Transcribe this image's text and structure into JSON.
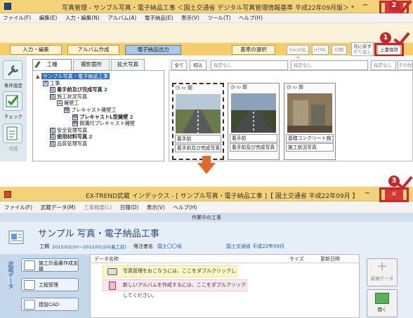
{
  "top": {
    "window_title": "写真管理 - サンプル写真・電子納品工事 ＜国土交通省 デジタル写真管理情報基準 平成22年09月版＞ *",
    "close_glyph": "×",
    "menu": [
      "ファイル(F)",
      "編集(E)",
      "入力・編集(N)",
      "アルバム(A)",
      "電子納品(E)",
      "表示(V)",
      "ツール(T)",
      "ヘルプ(H)"
    ],
    "tabs": [
      "入力・編集",
      "アルバム作成",
      "電子納品出力"
    ],
    "basis_button": "基準の選択",
    "tool_buttons": [
      "Excel出力",
      "HTML",
      "印刷"
    ],
    "undo_button": [
      "元に戻す",
      "やり直し"
    ],
    "save_button": "上書保存",
    "side_tools": [
      "条件設定",
      "チェック",
      "作成"
    ],
    "panel_tabs": [
      "工種",
      "撮影箇所",
      "拡大写真"
    ],
    "filter": {
      "all": "全て",
      "narrow": "絞込",
      "select1": "指定なし",
      "select2": "指定なし",
      "select3": "指定なし",
      "more": "その他条件"
    },
    "tree": [
      {
        "label": "サンプル写真・電子納品工事",
        "level": 0,
        "count": ""
      },
      {
        "label": "工事",
        "level": 1,
        "count": "",
        "tag": "大"
      },
      {
        "label": "着手前及び完成写真",
        "level": 2,
        "count": "2",
        "tag": "区"
      },
      {
        "label": "施工状況写真",
        "level": 2,
        "count": "",
        "tag": "区"
      },
      {
        "label": "擁壁工",
        "level": 3,
        "count": "",
        "tag": "工"
      },
      {
        "label": "プレキャスト擁壁工",
        "level": 4,
        "count": "",
        "tag": "種"
      },
      {
        "label": "プレキャストL型擁壁",
        "level": 5,
        "count": "2",
        "tag": "細"
      },
      {
        "label": "側溝付プレキャスト擁壁",
        "level": 5,
        "count": "",
        "tag": "細"
      },
      {
        "label": "安全管理写真",
        "level": 2,
        "count": "",
        "tag": "区"
      },
      {
        "label": "使用材料写真",
        "level": 2,
        "count": "2",
        "tag": "区"
      },
      {
        "label": "品質管理写真",
        "level": 2,
        "count": "",
        "tag": "区"
      }
    ],
    "photos": [
      {
        "icons": "◷ ▭ 前",
        "caption1": "着手前",
        "caption2": "着手前及び完成写真"
      },
      {
        "icons": "◷ ▭ 前",
        "caption1": "着手前",
        "caption2": "着手前及び完成写真"
      },
      {
        "icons": "◷ ▭ 前",
        "caption1": "基礎コンクリート施工...",
        "caption2": "施工状況写真"
      }
    ],
    "markers": [
      "2",
      "1"
    ]
  },
  "bottom": {
    "window_title": "EX-TREND武蔵 インデックス - [ サンプル写真・電子納品工事 ]【 国土交通省 平成22年09月 】",
    "close_glyph": "×",
    "menu": [
      "ファイル(F)",
      "武蔵データ(M)",
      "工事概要(L)",
      "日報(D)",
      "表示(V)",
      "ヘルプ(H)"
    ],
    "section_title": "作業中の工事",
    "project_name": "サンプル 写真・電子納品工事",
    "period_label": "工期",
    "period_value": "2015/03/20～2015/05/20(着工前)",
    "orderer_label": "発注者名",
    "orderer_value": "国土〇〇省",
    "standard": "国土交通省 平成22年09月",
    "side_label": "武蔵データ",
    "left_buttons": [
      "施工計画書作成支援",
      "工程管理",
      "建設CAD"
    ],
    "columns": [
      "データ名称",
      "サイズ",
      "更新日時"
    ],
    "notices": [
      "写真管理をおこなうには、ここをダブルクリックしてください。",
      "新しいアルバムを作成するには、ここをダブルクリックしてください。"
    ],
    "right_buttons": [
      "新規データ",
      "開く"
    ],
    "marker": "3"
  },
  "colors": {
    "accent_red": "#c7262d",
    "title_gold": "#f4d27a",
    "arrow": "#e06a2b"
  }
}
